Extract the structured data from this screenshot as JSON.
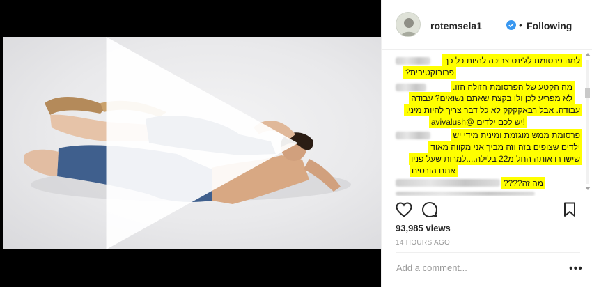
{
  "post": {
    "media_type": "video",
    "play_icon": "play-icon"
  },
  "header": {
    "username": "rotemsela1",
    "verified_icon": "verified-badge-icon",
    "separator": "•",
    "follow_status": "Following"
  },
  "comments": [
    {
      "user": "",
      "lines": [
        "למה פרסומת לג'ינס צריכה להיות כל כך",
        "פרובוקטיבית?"
      ]
    },
    {
      "user": "",
      "lines": [
        "מה הקטע של הפרסומת הזולה הזו.",
        "לא מפריע לכן ולו בקצת שאתם נשואים? עבודה",
        "עבודה. אבל רבאקקקק לא כל דבר צריך להיות מיני.",
        "!יש לכם ילדים @avivalush"
      ]
    },
    {
      "user": "",
      "lines": [
        "פרסומת ממש מוגזמת ומינית מידי יש",
        "ילדים שצופים בזה וזה מביך אני מקווה מאוד",
        "שישדרו אותה החל מ22 בלילה....למרות שעל פניו",
        "אתם הורסים"
      ]
    },
    {
      "user": "",
      "lines": [
        "מה זה????"
      ]
    }
  ],
  "actions": {
    "like_icon": "heart-icon",
    "comment_icon": "comment-icon",
    "save_icon": "bookmark-icon"
  },
  "stats": {
    "views": "93,985 views",
    "time_ago": "14 HOURS AGO"
  },
  "composer": {
    "placeholder": "Add a comment...",
    "more_label": "•••"
  },
  "colors": {
    "highlight": "#ffff00",
    "verified": "#3897f0",
    "text": "#262626",
    "muted": "#999999"
  }
}
